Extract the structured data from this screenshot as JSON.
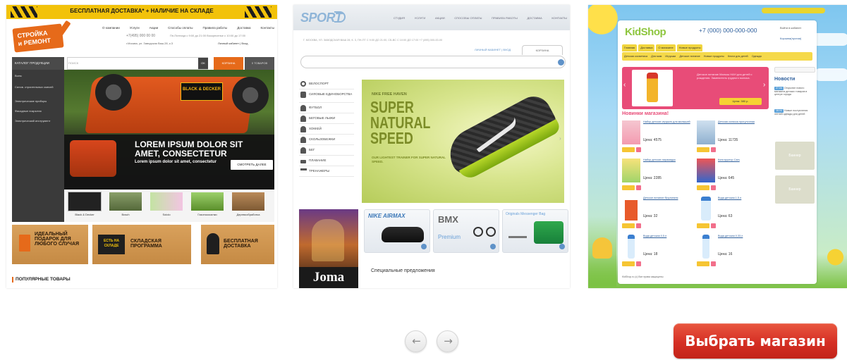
{
  "themes": [
    {
      "id": "stroyka",
      "top_banner": "БЕСПЛАТНАЯ ДОСТАВКА* + НАЛИЧИЕ НА СКЛАДЕ",
      "logo_line1": "СТРОЙКА",
      "logo_line2": "и РЕМОНТ",
      "nav": [
        "О компании",
        "Услуги",
        "Акции",
        "Способы оплаты",
        "Правила работы",
        "Доставка",
        "Контакты"
      ],
      "phone": "+7(495) 000 00 00",
      "hours": "Пн-Пятница с 9:00 до 21:00 Воскресенье с 10:00 до 17:00",
      "address": "г.Москва, ул. Заводская Ваш.28, к.3",
      "cabinet": "Личный кабинет | Вход",
      "catalog_label": "КАТАЛОГ ПРОДУКЦИИ",
      "search_label": "ПОИСК",
      "search_button": "OK",
      "cart_label": "КОРЗИНА",
      "goods_label": "0 ТОВАРОВ",
      "sidebar_items": [
        "Всем",
        "Силов. строительных смесей",
        "Электрические приборы",
        "Фасадные покрытия",
        "Электрический инструмент"
      ],
      "hero_brand": "BLACK & DECKER",
      "hero_title": "LOREM IPSUM DOLOR SIT AMET, CONSECTETUR",
      "hero_subtitle": "Lorem ipsum dolor sit amet, consectetur",
      "hero_button": "СМОТРЕТЬ ДАЛЕЕ",
      "brands": [
        "Black & Decker",
        "Bosch",
        "Sololo",
        "Газонокосилки",
        "Деревообработка"
      ],
      "promos": [
        {
          "text": "ИДЕАЛЬНЫЙ ПОДАРОК ДЛЯ ЛЮБОГО СЛУЧАЯ"
        },
        {
          "badge": "ЕСТЬ НА СКЛАДЕ",
          "text": "СКЛАДСКАЯ ПРОГРАММА"
        },
        {
          "text": "БЕСПЛАТНАЯ ДОСТАВКА"
        }
      ],
      "popular_heading": "ПОПУЛЯРНЫЕ ТОВАРЫ"
    },
    {
      "id": "sport",
      "logo": "SPORT",
      "nav": [
        "СТУДИЯ",
        "УСЛУГИ",
        "АКЦИИ",
        "СПОСОБЫ ОПЛАТЫ",
        "ПРАВИЛА РАБОТЫ",
        "ДОСТАВКА",
        "КОНТАКТЫ"
      ],
      "crumb": "Г. МОСКВА, УЛ. ЗАВОДСКАЯ ВАШ 28, К. 3, ПН-ПТ С 9:00 ДО 21:00, СБ-ВС С 10:00 ДО 17:00 +7 (495) 000-00-00",
      "login": "ЛИЧНЫЙ КАБИНЕТ | ВХОД",
      "cart_tab": "КОРЗИНА",
      "menu": [
        "ВЕЛОСПОРТ",
        "СИЛОВЫЕ ЕДИНОБОРСТВА",
        "ФУТБОЛ",
        "БЕГОВЫЕ ЛЫЖИ",
        "ХОККЕЙ",
        "СКОЛЬЗОБЕЖКИ",
        "БЕГ",
        "ПЛАВАНИЕ",
        "ТРЕНАЖЕРЫ"
      ],
      "banner_kicker": "NIKE FREE HAVEN",
      "banner_title": "SUPER NATURAL SPEED",
      "banner_sub": "OUR LIGHTEST TRAINER FOR SUPER NATURAL SPEED.",
      "joma_logo": "Joma",
      "cards": [
        {
          "title": "NIKE AIRMAX"
        },
        {
          "title": "BMX",
          "sub": "Premium"
        },
        {
          "title": "Originals Messenger Bag"
        }
      ],
      "special": "Специальные предложения"
    },
    {
      "id": "kidshop",
      "logo": "KidShop",
      "phone": "+7 (000) 000-000-000",
      "account": "Войти в кабинет",
      "cart_link": "Корзина(пустая)",
      "menu": [
        "Главная",
        "Доставка",
        "О магазине",
        "Новые продукты"
      ],
      "categories": [
        "Детская косметика",
        "Для мам",
        "Игрушки",
        "Детское питание",
        "Новые продукты",
        "Книги для детей",
        "Одежда"
      ],
      "slide_text": "Детское питание Малыш НАН для детей с рождения. Заменитель грудного молока.",
      "slide_price": "Цена: 380 р.",
      "news_title": "Новости",
      "news_items": [
        {
          "date": "27.04",
          "text": "Открытие нового магазина детских товаров в центре города"
        },
        {
          "date": "18.04",
          "text": "Новые поступления летней одежды для детей"
        }
      ],
      "banners": [
        "Баннер",
        "Баннер"
      ],
      "section_title": "Новинки магазина!",
      "products": [
        {
          "title": "Набор детских игрушек для малышей",
          "price": "Цена: 4575"
        },
        {
          "title": "Детская коляска прогулочная",
          "price": "Цена: 11735"
        },
        {
          "title": "Набор детских пирамидок",
          "price": "Цена: 2285"
        },
        {
          "title": "Конструктор Cars",
          "price": "Цена: 645"
        },
        {
          "title": "Детское питание Фрутоняня",
          "price": "Цена: 32"
        },
        {
          "title": "Вода детская 1,5 л",
          "price": "Цена: 63"
        },
        {
          "title": "Вода детская 0,5 л",
          "price": "Цена: 18"
        },
        {
          "title": "Вода детская 0,33 л",
          "price": "Цена: 16"
        }
      ],
      "footer": "KidShop.ru (c) Все права защищены"
    }
  ],
  "controls": {
    "prev_icon": "arrow-left-icon",
    "prev_glyph": "←",
    "next_icon": "arrow-right-icon",
    "next_glyph": "→",
    "select_button": "Выбрать магазин",
    "select_color": "#d7322a"
  }
}
